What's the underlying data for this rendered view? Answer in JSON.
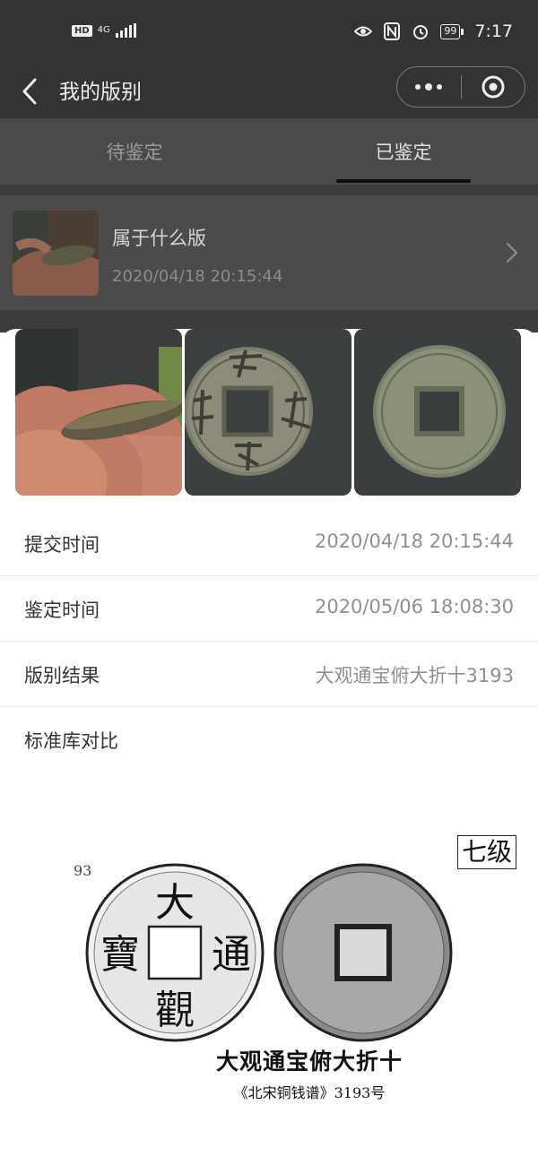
{
  "status_bar": {
    "hd": "HD",
    "network": "4G",
    "battery": "99",
    "time": "7:17",
    "icons": [
      "eye-icon",
      "nfc-icon",
      "alarm-icon"
    ]
  },
  "nav": {
    "title": "我的版别",
    "back_icon": "chevron-left-icon",
    "more_icon": "more-dots-icon",
    "close_icon": "target-circle-icon"
  },
  "tabs": [
    {
      "label": "待鉴定",
      "active": false
    },
    {
      "label": "已鉴定",
      "active": true
    }
  ],
  "list": {
    "items": [
      {
        "title": "属于什么版",
        "time": "2020/04/18 20:15:44"
      }
    ]
  },
  "detail": {
    "rows": [
      {
        "label": "提交时间",
        "value": "2020/04/18 20:15:44"
      },
      {
        "label": "鉴定时间",
        "value": "2020/05/06 18:08:30"
      },
      {
        "label": "版别结果",
        "value": "大观通宝俯大折十3193"
      },
      {
        "label": "标准库对比",
        "value": ""
      }
    ],
    "reference": {
      "grade": "七级",
      "number": "93",
      "coin_characters": [
        "大",
        "觀",
        "通",
        "寶"
      ],
      "caption": "大观通宝俯大折十",
      "source": "《北宋铜钱谱》3193号"
    }
  },
  "colors": {
    "overlay": "#333333",
    "sheet": "#ffffff",
    "value_text": "#8f8f8f",
    "label_text": "#333333"
  }
}
